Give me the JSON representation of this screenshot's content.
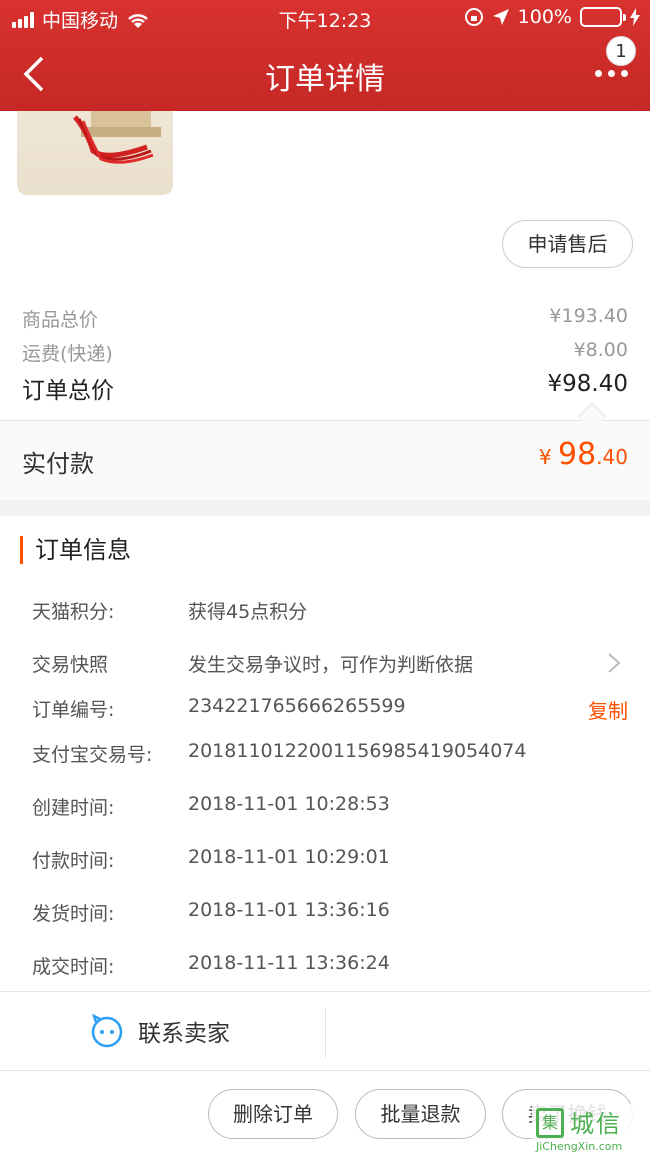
{
  "status_bar": {
    "carrier": "中国移动",
    "time": "下午12:23",
    "battery": "100%"
  },
  "nav": {
    "title": "订单详情",
    "badge": "1"
  },
  "product": {
    "after_sale_button": "申请售后"
  },
  "prices": {
    "goods_label": "商品总价",
    "goods_value": "¥193.40",
    "shipping_label": "运费(快递)",
    "shipping_value": "¥8.00",
    "total_label": "订单总价",
    "total_value": "¥98.40",
    "paid_label": "实付款",
    "paid_currency": "¥",
    "paid_int": "98",
    "paid_dec": ".40"
  },
  "order_info": {
    "title": "订单信息",
    "rows": [
      {
        "label": "天猫积分:",
        "value": "获得45点积分"
      },
      {
        "label": "交易快照",
        "value": "发生交易争议时，可作为判断依据"
      },
      {
        "label": "订单编号:",
        "value": "234221765666265599"
      },
      {
        "label": "支付宝交易号:",
        "value": "2018110122001156985419054074"
      },
      {
        "label": "创建时间:",
        "value": "2018-11-01 10:28:53"
      },
      {
        "label": "付款时间:",
        "value": "2018-11-01 10:29:01"
      },
      {
        "label": "发货时间:",
        "value": "2018-11-01 13:36:16"
      },
      {
        "label": "成交时间:",
        "value": "2018-11-11 13:36:24"
      }
    ],
    "copy_label": "复制"
  },
  "contact": {
    "label": "联系卖家"
  },
  "actions": {
    "delete": "删除订单",
    "bulk_refund": "批量退款",
    "sell": "卖了换钱"
  },
  "watermark": {
    "box": "集",
    "text": "城信",
    "url": "JiChengXin.com"
  },
  "colors": {
    "header": "#c52825",
    "accent": "#ff5000"
  }
}
